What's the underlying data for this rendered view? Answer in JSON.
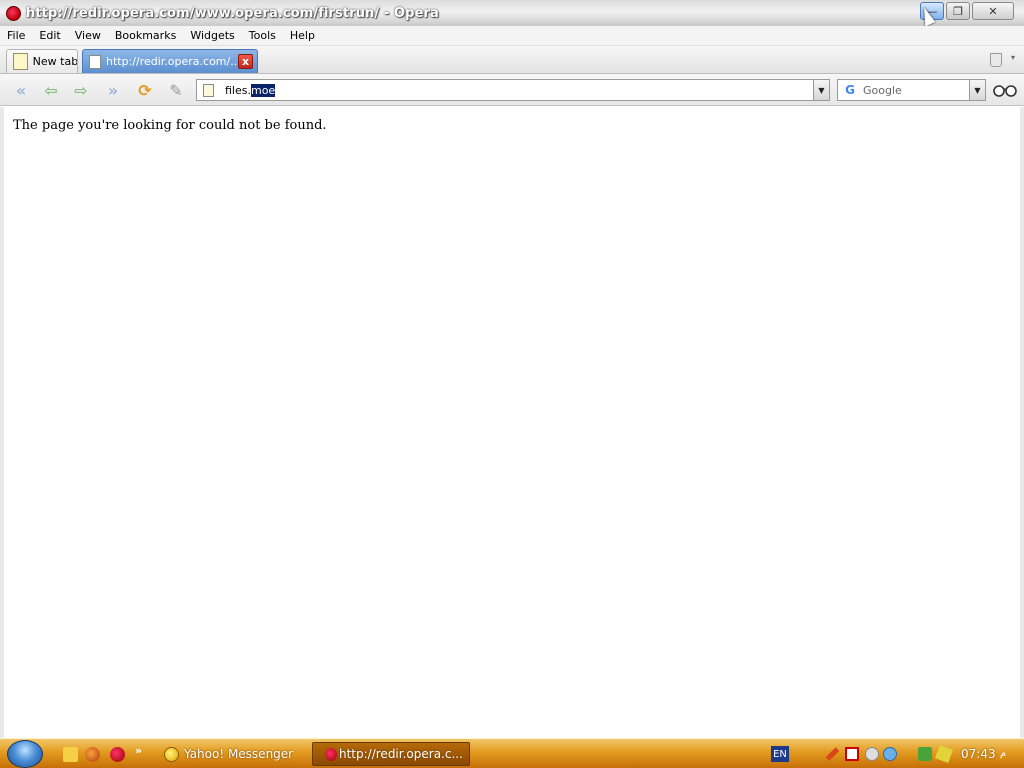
{
  "window": {
    "title": "http://redir.opera.com/www.opera.com/firstrun/ - Opera",
    "min_symbol": "—",
    "max_symbol": "❐",
    "close_symbol": "✕"
  },
  "menu": {
    "items": [
      "File",
      "Edit",
      "View",
      "Bookmarks",
      "Widgets",
      "Tools",
      "Help"
    ]
  },
  "tabs": [
    {
      "label": "New tab",
      "icon": "new-tab-icon"
    },
    {
      "label": "http://redir.opera.com/...",
      "icon": "page-icon",
      "close": "x"
    }
  ],
  "toolbar": {
    "rewind": "«",
    "back": "⇦",
    "forward": "⇨",
    "fast_forward": "»",
    "reload": "⟳",
    "edit": "✎"
  },
  "address": {
    "text_plain": "files.",
    "text_selected": "moe",
    "dropdown": "▼"
  },
  "search": {
    "engine_glyph": "G",
    "placeholder": "Google",
    "dropdown": "▼"
  },
  "content": {
    "message": "The page you're looking for could not be found."
  },
  "taskbar": {
    "chevron": "»",
    "yahoo_label": "Yahoo! Messenger",
    "opera_label": "http://redir.opera.c...",
    "language": "EN",
    "clock": "07:43",
    "clock_suffix": "م"
  }
}
